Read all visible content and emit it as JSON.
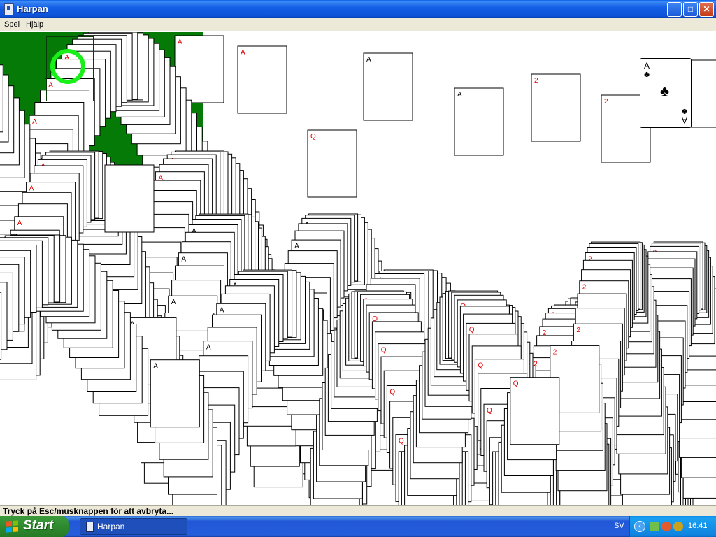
{
  "window": {
    "title": "Harpan",
    "controls": {
      "minimize": "_",
      "maximize": "□",
      "close": "✕"
    }
  },
  "menu": {
    "items": [
      "Spel",
      "Hjälp"
    ]
  },
  "game": {
    "felt_color": "#057a06",
    "stock_ring_color": "#19ef18",
    "top_card": {
      "rank": "A",
      "suit": "♣"
    }
  },
  "status": {
    "text": "Tryck på Esc/musknappen för att avbryta..."
  },
  "taskbar": {
    "start_label": "Start",
    "task_button": "Harpan",
    "language": "SV",
    "tray_expand": "‹",
    "clock": "16:41"
  },
  "colors": {
    "title_bar": "#0a5ee6",
    "taskbar": "#245edc",
    "start_green": "#2f8a2f",
    "card_red": "#e00000"
  },
  "icons": [
    "app-window-icon",
    "windows-logo-icon",
    "tray-network-icon",
    "tray-sound-icon",
    "tray-antivirus-icon"
  ]
}
